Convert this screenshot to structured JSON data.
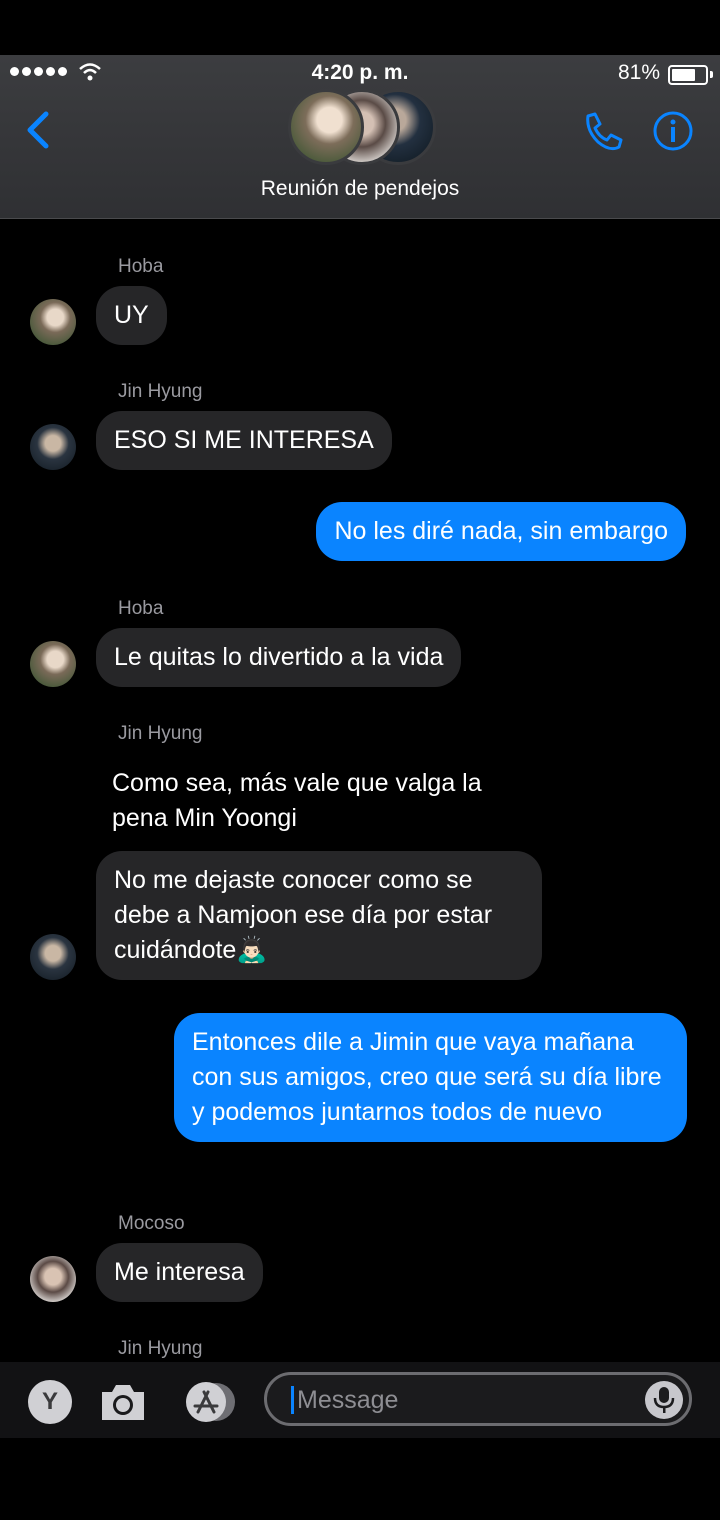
{
  "status_bar": {
    "time": "4:20 p. m.",
    "battery": "81%",
    "battery_level": 0.81
  },
  "header": {
    "group_name": "Reunión de pendejos"
  },
  "messages": [
    {
      "sender": "Hoba",
      "text": "UY"
    },
    {
      "sender": "Jin Hyung",
      "text": "ESO SI ME INTERESA"
    },
    {
      "text": "No les diré nada, sin embargo"
    },
    {
      "sender": "Hoba",
      "text": "Le quitas lo divertido a la vida"
    },
    {
      "sender": "Jin Hyung",
      "text": "Como sea, más vale que valga la pena Min Yoongi"
    },
    {
      "text": "No me dejaste conocer como se debe a Namjoon ese día por estar cuidándote🙇🏻‍♂️"
    },
    {
      "text": "Entonces dile a Jimin que vaya mañana con sus amigos, creo que será su día libre y podemos juntarnos todos de nuevo"
    },
    {
      "sender": "Mocoso",
      "text": "Me interesa"
    },
    {
      "sender": "Jin Hyung"
    }
  ],
  "input_bar": {
    "app_button": "Y",
    "placeholder": "Message"
  },
  "colors": {
    "accent": "#0a84ff",
    "incoming_bubble": "#262628",
    "background": "#000000"
  },
  "icons": [
    "back-chevron-icon",
    "phone-icon",
    "info-icon",
    "camera-icon",
    "app-store-icon",
    "microphone-icon"
  ]
}
